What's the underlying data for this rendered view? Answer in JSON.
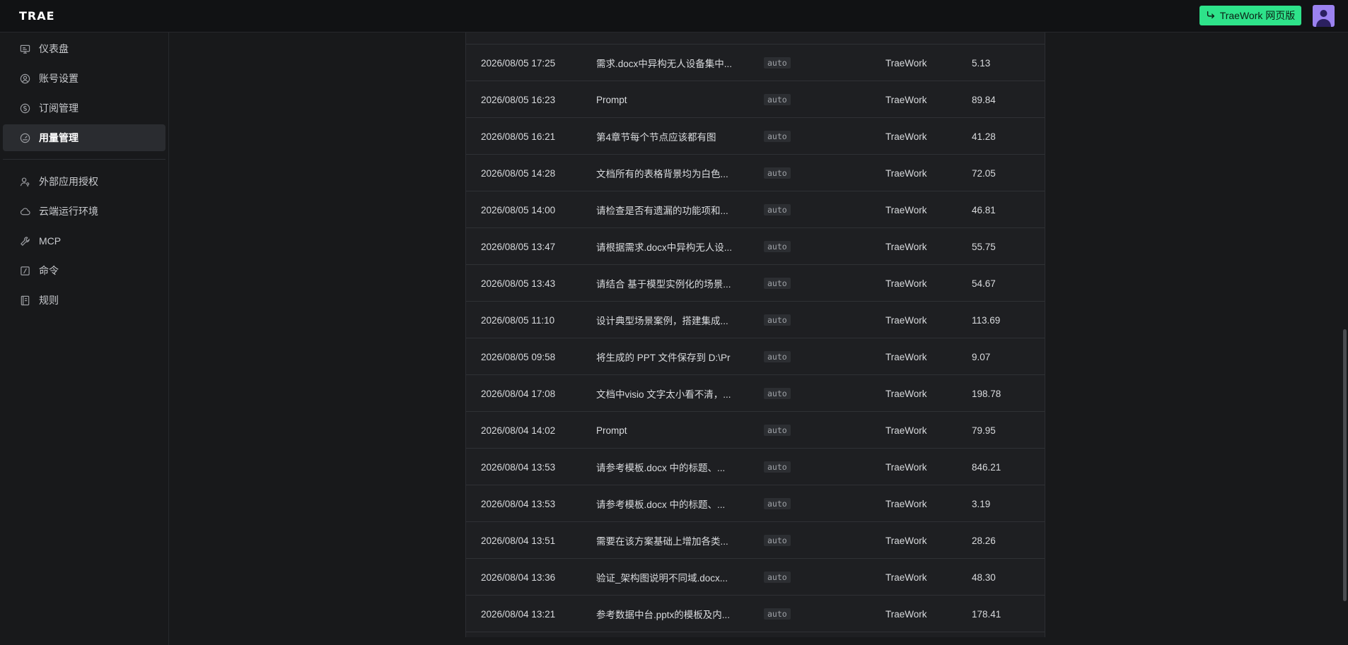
{
  "header": {
    "logo": "TRAE",
    "web_button_label": "TraeWork 网页版"
  },
  "sidebar": {
    "items": [
      {
        "label": "仪表盘",
        "icon": "monitor-icon",
        "active": false
      },
      {
        "label": "账号设置",
        "icon": "user-circle-icon",
        "active": false
      },
      {
        "label": "订阅管理",
        "icon": "dollar-circle-icon",
        "active": false
      },
      {
        "label": "用量管理",
        "icon": "gauge-icon",
        "active": true
      },
      {
        "label": "外部应用授权",
        "icon": "user-key-icon",
        "active": false
      },
      {
        "label": "云端运行环境",
        "icon": "cloud-icon",
        "active": false
      },
      {
        "label": "MCP",
        "icon": "wrench-icon",
        "active": false
      },
      {
        "label": "命令",
        "icon": "slash-command-icon",
        "active": false
      },
      {
        "label": "规则",
        "icon": "book-icon",
        "active": false
      }
    ]
  },
  "usage_table": {
    "rows": [
      {
        "time": "2026/08/05 17:25",
        "task": "需求.docx中异构无人设备集中...",
        "model": "auto",
        "product": "TraeWork",
        "usage": "5.13"
      },
      {
        "time": "2026/08/05 16:23",
        "task": "Prompt",
        "model": "auto",
        "product": "TraeWork",
        "usage": "89.84"
      },
      {
        "time": "2026/08/05 16:21",
        "task": "第4章节每个节点应该都有图",
        "model": "auto",
        "product": "TraeWork",
        "usage": "41.28"
      },
      {
        "time": "2026/08/05 14:28",
        "task": "文档所有的表格背景均为白色...",
        "model": "auto",
        "product": "TraeWork",
        "usage": "72.05"
      },
      {
        "time": "2026/08/05 14:00",
        "task": "请检查是否有遗漏的功能项和...",
        "model": "auto",
        "product": "TraeWork",
        "usage": "46.81"
      },
      {
        "time": "2026/08/05 13:47",
        "task": "请根据需求.docx中异构无人设...",
        "model": "auto",
        "product": "TraeWork",
        "usage": "55.75"
      },
      {
        "time": "2026/08/05 13:43",
        "task": "请结合 基于模型实例化的场景...",
        "model": "auto",
        "product": "TraeWork",
        "usage": "54.67"
      },
      {
        "time": "2026/08/05 11:10",
        "task": "设计典型场景案例，搭建集成...",
        "model": "auto",
        "product": "TraeWork",
        "usage": "113.69"
      },
      {
        "time": "2026/08/05 09:58",
        "task": "将生成的 PPT 文件保存到 D:\\Pr",
        "model": "auto",
        "product": "TraeWork",
        "usage": "9.07"
      },
      {
        "time": "2026/08/04 17:08",
        "task": "文档中visio 文字太小看不清，...",
        "model": "auto",
        "product": "TraeWork",
        "usage": "198.78"
      },
      {
        "time": "2026/08/04 14:02",
        "task": "Prompt",
        "model": "auto",
        "product": "TraeWork",
        "usage": "79.95"
      },
      {
        "time": "2026/08/04 13:53",
        "task": "请参考模板.docx 中的标题、...",
        "model": "auto",
        "product": "TraeWork",
        "usage": "846.21"
      },
      {
        "time": "2026/08/04 13:53",
        "task": "请参考模板.docx 中的标题、...",
        "model": "auto",
        "product": "TraeWork",
        "usage": "3.19"
      },
      {
        "time": "2026/08/04 13:51",
        "task": "需要在该方案基础上增加各类...",
        "model": "auto",
        "product": "TraeWork",
        "usage": "28.26"
      },
      {
        "time": "2026/08/04 13:36",
        "task": "验证_架构图说明不同域.docx...",
        "model": "auto",
        "product": "TraeWork",
        "usage": "48.30"
      },
      {
        "time": "2026/08/04 13:21",
        "task": "参考数据中台.pptx的模板及内...",
        "model": "auto",
        "product": "TraeWork",
        "usage": "178.41"
      }
    ]
  }
}
